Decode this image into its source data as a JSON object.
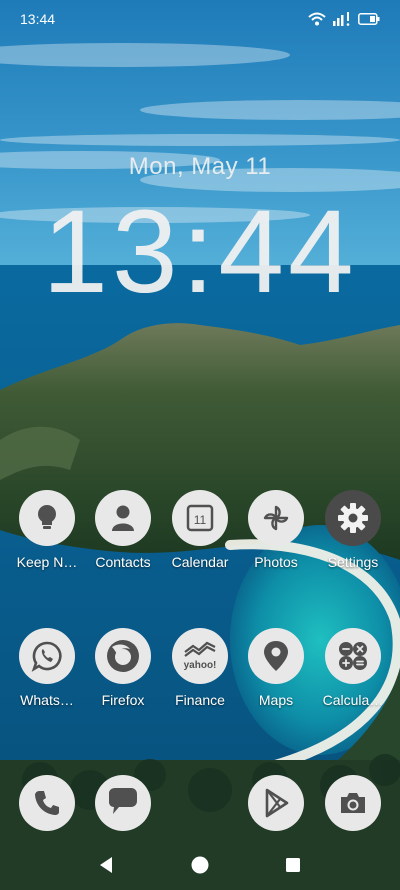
{
  "status": {
    "time": "13:44"
  },
  "lockscreen": {
    "date": "Mon, May 11",
    "clock": "13:44"
  },
  "apps_row1": [
    {
      "label": "Keep N…",
      "icon": "bulb-icon"
    },
    {
      "label": "Contacts",
      "icon": "person-icon"
    },
    {
      "label": "Calendar",
      "icon": "calendar-icon",
      "day": "11"
    },
    {
      "label": "Photos",
      "icon": "pinwheel-icon"
    },
    {
      "label": "Settings",
      "icon": "gear-icon"
    }
  ],
  "apps_row2": [
    {
      "label": "Whats…",
      "icon": "whatsapp-icon"
    },
    {
      "label": "Firefox",
      "icon": "firefox-icon"
    },
    {
      "label": "Finance",
      "icon": "finance-icon",
      "brand": "yahoo!"
    },
    {
      "label": "Maps",
      "icon": "map-pin-icon"
    },
    {
      "label": "Calcula…",
      "icon": "calculator-icon"
    }
  ],
  "dock": [
    {
      "icon": "phone-icon"
    },
    {
      "icon": "messages-icon"
    },
    {
      "icon": "play-store-icon"
    },
    {
      "icon": "camera-icon"
    }
  ],
  "colors": {
    "icon_bg": "#e8e8e8",
    "icon_fg": "#505050",
    "settings_bg": "#4a4a4a"
  }
}
